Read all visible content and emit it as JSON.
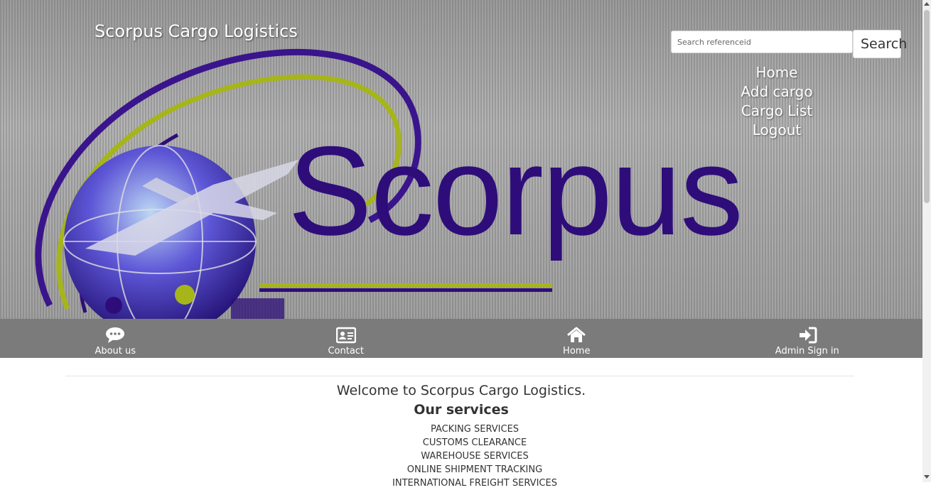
{
  "header": {
    "brand_title": "Scorpus Cargo Logistics",
    "logo_wordmark": "Scorpus"
  },
  "search": {
    "placeholder": "Search referenceid",
    "value": "",
    "button_label": "Search"
  },
  "side_nav": {
    "items": [
      {
        "label": "Home"
      },
      {
        "label": "Add cargo"
      },
      {
        "label": "Cargo List"
      },
      {
        "label": "Logout"
      }
    ]
  },
  "navbar": {
    "items": [
      {
        "label": "About us",
        "icon": "chat-bubble-icon"
      },
      {
        "label": "Contact",
        "icon": "contact-card-icon"
      },
      {
        "label": "Home",
        "icon": "home-icon"
      },
      {
        "label": "Admin Sign in",
        "icon": "sign-in-icon"
      }
    ]
  },
  "main": {
    "welcome": "Welcome to Scorpus Cargo Logistics.",
    "services_heading": "Our services",
    "services": [
      "PACKING SERVICES",
      "CUSTOMS CLEARANCE",
      "WAREHOUSE SERVICES",
      "ONLINE SHIPMENT TRACKING",
      "INTERNATIONAL FREIGHT SERVICES"
    ]
  },
  "colors": {
    "brand_purple": "#2e0d7a",
    "accent_lime": "#a6b51a",
    "navbar_bg": "#7b7b7b"
  }
}
